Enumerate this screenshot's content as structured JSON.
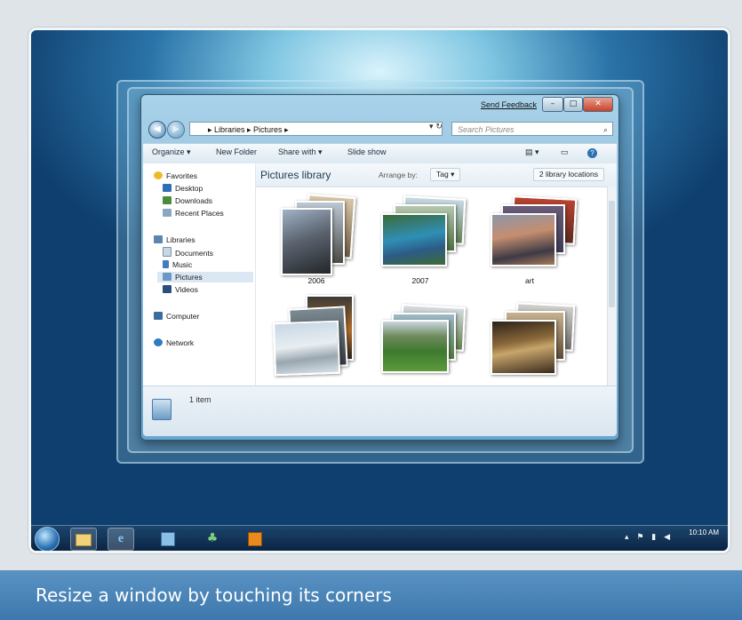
{
  "window": {
    "send_feedback": "Send Feedback",
    "minimize": "–",
    "maximize": "□",
    "close": "✕"
  },
  "address": {
    "path": "▸ Libraries ▸ Pictures ▸",
    "search_placeholder": "Search Pictures"
  },
  "toolbar": {
    "organize": "Organize ▾",
    "new_folder": "New Folder",
    "share_with": "Share with ▾",
    "slide_show": "Slide show"
  },
  "sidebar": {
    "favorites": "Favorites",
    "desktop": "Desktop",
    "downloads": "Downloads",
    "recent_places": "Recent Places",
    "libraries": "Libraries",
    "documents": "Documents",
    "music": "Music",
    "pictures": "Pictures",
    "videos": "Videos",
    "computer": "Computer",
    "network": "Network"
  },
  "library": {
    "title": "Pictures library",
    "arrange_by": "Arrange by:",
    "arrange_value": "Tag ▾",
    "locations": "2 library locations"
  },
  "folders": [
    {
      "label": "2006"
    },
    {
      "label": "2007"
    },
    {
      "label": "art"
    },
    {
      "label": ""
    },
    {
      "label": ""
    },
    {
      "label": ""
    }
  ],
  "status": {
    "count": "1 item"
  },
  "taskbar": {
    "clock": "10:10 AM"
  },
  "caption": {
    "text": "Resize a window by touching its corners"
  },
  "colors": {
    "caption_bg": "#4a86b8",
    "desktop_glow": "#d9f3fb",
    "desktop_dark": "#0f3f6e"
  }
}
